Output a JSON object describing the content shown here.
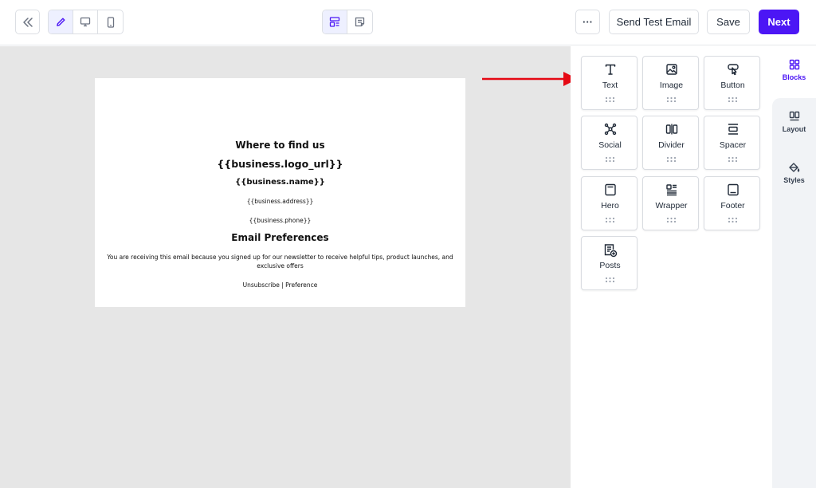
{
  "colors": {
    "accent": "#4c16f5",
    "canvas": "#e6e6e6",
    "arrow": "#e50914"
  },
  "toolbar": {
    "collapse_icon": "double-chevron-left-icon",
    "device_modes": [
      {
        "icon": "pencil-icon",
        "active": true
      },
      {
        "icon": "desktop-icon",
        "active": false
      },
      {
        "icon": "mobile-icon",
        "active": false
      }
    ],
    "view_modes": [
      {
        "icon": "layout-icon",
        "active": true
      },
      {
        "icon": "document-icon",
        "active": false
      }
    ],
    "more_label": "···",
    "send_test_label": "Send Test Email",
    "save_label": "Save",
    "next_label": "Next"
  },
  "email": {
    "heading": "Where to find us",
    "logo_url": "{{business.logo_url}}",
    "name": "{{business.name}}",
    "address": "{{business.address}}",
    "phone": "{{business.phone}}",
    "prefs_heading": "Email Preferences",
    "notice_line1": "You are receiving this email because you signed up for our newsletter to receive helpful tips, product launches, and",
    "notice_line2": "exclusive offers",
    "footer_links": "Unsubscribe | Preference"
  },
  "blocks": [
    {
      "label": "Text",
      "icon": "text-icon"
    },
    {
      "label": "Image",
      "icon": "image-icon"
    },
    {
      "label": "Button",
      "icon": "button-icon"
    },
    {
      "label": "Social",
      "icon": "social-icon"
    },
    {
      "label": "Divider",
      "icon": "divider-icon"
    },
    {
      "label": "Spacer",
      "icon": "spacer-icon"
    },
    {
      "label": "Hero",
      "icon": "hero-icon"
    },
    {
      "label": "Wrapper",
      "icon": "wrapper-icon"
    },
    {
      "label": "Footer",
      "icon": "footer-icon"
    },
    {
      "label": "Posts",
      "icon": "posts-icon"
    }
  ],
  "rail": {
    "items": [
      {
        "label": "Blocks",
        "icon": "blocks-icon",
        "active": true
      },
      {
        "label": "Layout",
        "icon": "layout-columns-icon",
        "active": false
      },
      {
        "label": "Styles",
        "icon": "paint-bucket-icon",
        "active": false
      }
    ]
  }
}
